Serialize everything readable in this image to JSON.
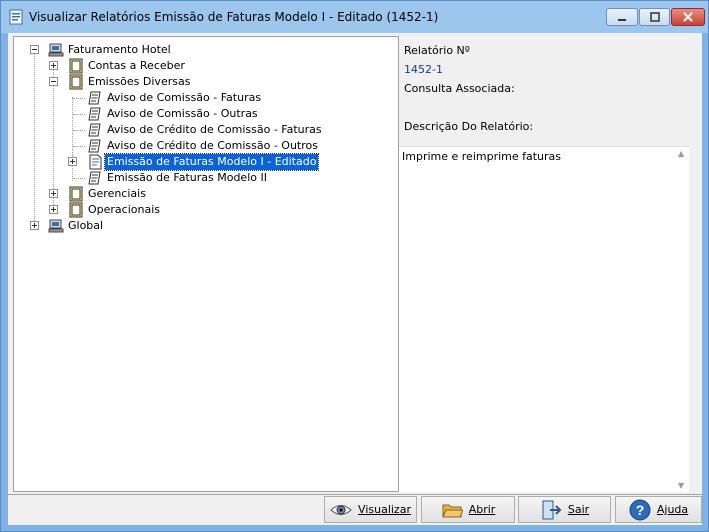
{
  "window": {
    "title": "Visualizar Relatórios Emissão de Faturas Modelo I - Editado (1452-1)"
  },
  "tree": {
    "root": "Faturamento Hotel",
    "contas": "Contas a Receber",
    "emissoes": "Emissões Diversas",
    "items": [
      "Aviso de Comissão - Faturas",
      "Aviso de Comissão - Outras",
      "Aviso de Crédito de Comissão - Faturas",
      "Aviso de Crédito de Comissão - Outros",
      "Emissão de Faturas Modelo I - Editado",
      "Emissão de Faturas Modelo II"
    ],
    "gerenciais": "Gerenciais",
    "operacionais": "Operacionais",
    "global": "Global",
    "selected_index": 4
  },
  "props": {
    "relatorio_label": "Relatório Nº",
    "relatorio_value": "1452-1",
    "consulta_label": "Consulta Associada:",
    "descricao_label": "Descrição Do Relatório:",
    "descricao_value": "Imprime e reimprime faturas"
  },
  "buttons": {
    "visualizar": "Visualizar",
    "abrir": "Abrir",
    "sair": "Sair",
    "ajuda": "Ajuda"
  },
  "icons": {
    "window": "report-icon",
    "root": "computer-icon",
    "folder": "folder-doc-icon",
    "report": "report-doc-icon",
    "visualizar": "eye-icon",
    "abrir": "folder-open-icon",
    "sair": "exit-icon",
    "ajuda": "help-icon"
  },
  "colors": {
    "titlebar": "#9cc6ee",
    "selection": "#0a64d6",
    "value_text": "#1d3a8a"
  }
}
